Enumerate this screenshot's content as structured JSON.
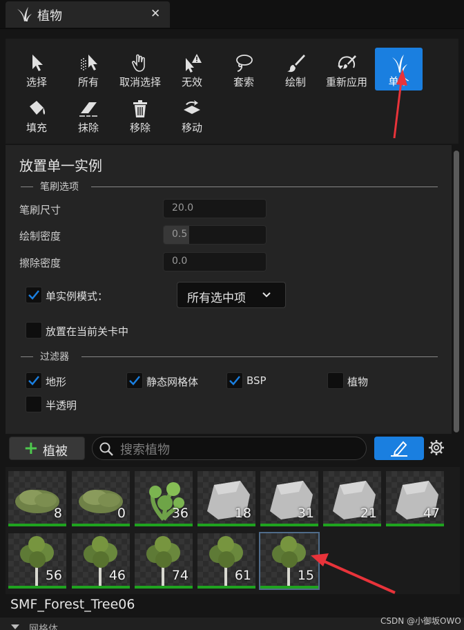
{
  "tab": {
    "title": "植物",
    "close_label": "✕"
  },
  "toolbar": {
    "tools": [
      {
        "label": "选择",
        "icon": "cursor-icon"
      },
      {
        "label": "所有",
        "icon": "select-all-icon"
      },
      {
        "label": "取消选择",
        "icon": "deselect-hand-icon"
      },
      {
        "label": "无效",
        "icon": "invalid-cursor-icon"
      },
      {
        "label": "套索",
        "icon": "lasso-icon"
      },
      {
        "label": "绘制",
        "icon": "paint-brush-icon"
      },
      {
        "label": "重新应用",
        "icon": "reapply-icon"
      },
      {
        "label": "单个",
        "icon": "single-foliage-icon"
      },
      {
        "label": "填充",
        "icon": "fill-bucket-icon"
      },
      {
        "label": "抹除",
        "icon": "eraser-icon"
      },
      {
        "label": "移除",
        "icon": "trash-icon"
      },
      {
        "label": "移动",
        "icon": "move-icon"
      }
    ]
  },
  "details": {
    "title": "放置单一实例",
    "brush_section": "笔刷选项",
    "brush_size_label": "笔刷尺寸",
    "brush_size_value": "20.0",
    "paint_density_label": "绘制密度",
    "paint_density_value": "0.5",
    "paint_density_fraction": 0.5,
    "erase_density_label": "擦除密度",
    "erase_density_value": "0.0",
    "single_instance_mode_label": "单实例模式：",
    "single_instance_mode_checked": true,
    "single_instance_mode_option": "所有选中项",
    "place_in_current_level_label": "放置在当前关卡中",
    "place_in_current_level_checked": false,
    "filter_section": "过滤器",
    "filters": [
      {
        "label": "地形",
        "checked": true
      },
      {
        "label": "静态网格体",
        "checked": true
      },
      {
        "label": "BSP",
        "checked": true
      },
      {
        "label": "植物",
        "checked": false
      },
      {
        "label": "半透明",
        "checked": false
      }
    ]
  },
  "palette": {
    "add_label": "植被",
    "search_placeholder": "搜索植物",
    "items": [
      {
        "count": "8",
        "kind": "bush"
      },
      {
        "count": "0",
        "kind": "bush"
      },
      {
        "count": "36",
        "kind": "plant"
      },
      {
        "count": "18",
        "kind": "rock"
      },
      {
        "count": "31",
        "kind": "rock"
      },
      {
        "count": "21",
        "kind": "rock"
      },
      {
        "count": "47",
        "kind": "rock"
      },
      {
        "count": "56",
        "kind": "tree"
      },
      {
        "count": "46",
        "kind": "tree"
      },
      {
        "count": "74",
        "kind": "tree"
      },
      {
        "count": "61",
        "kind": "tree"
      },
      {
        "count": "15",
        "kind": "tree",
        "selected": true
      }
    ],
    "selected_name": "SMF_Forest_Tree06",
    "category_label": "网格体"
  },
  "watermark": "CSDN @小御坂OWO",
  "colors": {
    "accent": "#1a7fe0",
    "count_bar": "#1fa31f",
    "annotation": "#e8333a"
  }
}
